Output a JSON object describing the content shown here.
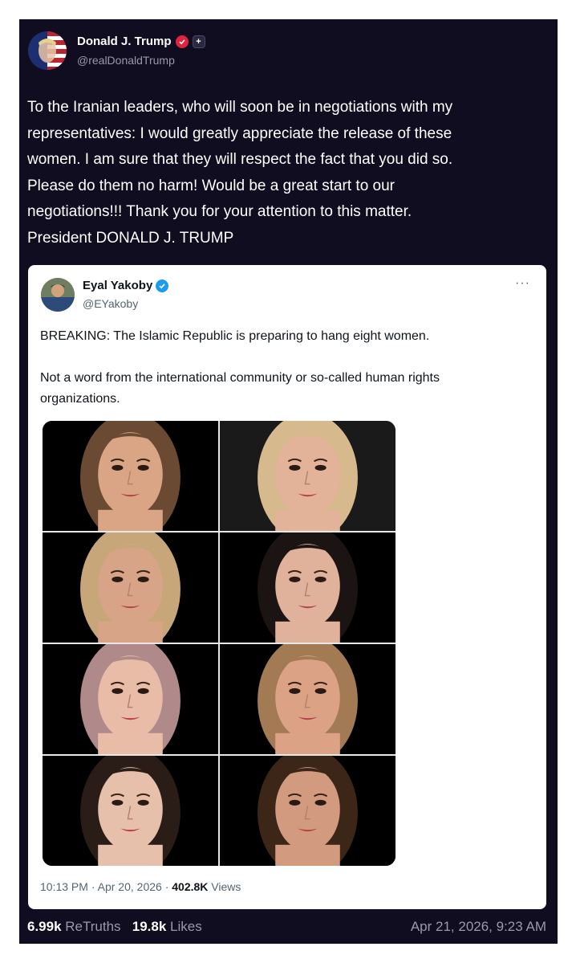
{
  "post": {
    "author_name": "Donald J. Trump",
    "author_handle": "@realDonaldTrump",
    "verified_icon": "verified-badge-icon",
    "plus_icon": "plus-icon",
    "text": "To the Iranian leaders, who will soon be in negotiations with my\nrepresentatives: I would greatly appreciate the release of these\nwomen. I am sure that they will respect the fact that you did so.\nPlease do them no harm! Would be a great start to our\nnegotiations!!! Thank you for your attention to this matter.\nPresident DONALD J. TRUMP",
    "retruths_count": "6.99k",
    "retruths_label": "ReTruths",
    "likes_count": "19.8k",
    "likes_label": "Likes",
    "timestamp": "Apr 21, 2026, 9:23 AM",
    "background_color": "#100d21"
  },
  "quote": {
    "author_name": "Eyal Yakoby",
    "author_handle": "@EYakoby",
    "more_label": "···",
    "text": "BREAKING: The Islamic Republic is preparing to hang eight women.\n\nNot a word from the international community or so-called human rights\norganizations.",
    "time": "10:13 PM",
    "date": "Apr 20, 2026",
    "views_count": "402.8K",
    "views_label": "Views",
    "separator": "·",
    "check_color": "#1d9bf0"
  },
  "photos": [
    {
      "name": "woman-portrait-1",
      "hair": "#6b4a34",
      "skin": "#d9a585",
      "bg": "#000000"
    },
    {
      "name": "woman-portrait-2",
      "hair": "#d6b98c",
      "skin": "#e2b398",
      "bg": "#1a1a1a"
    },
    {
      "name": "woman-portrait-3",
      "hair": "#c7a77a",
      "skin": "#d8a488",
      "bg": "#000000"
    },
    {
      "name": "woman-portrait-4",
      "hair": "#1c1412",
      "skin": "#e0b29c",
      "bg": "#000000"
    },
    {
      "name": "woman-portrait-5",
      "hair": "#b08a8a",
      "skin": "#e8bca6",
      "bg": "#000000"
    },
    {
      "name": "woman-portrait-6",
      "hair": "#a27a54",
      "skin": "#dba286",
      "bg": "#000000"
    },
    {
      "name": "woman-portrait-7",
      "hair": "#2a1c16",
      "skin": "#e6c0aa",
      "bg": "#000000"
    },
    {
      "name": "woman-portrait-8",
      "hair": "#3b2618",
      "skin": "#d29a7e",
      "bg": "#000000"
    }
  ]
}
